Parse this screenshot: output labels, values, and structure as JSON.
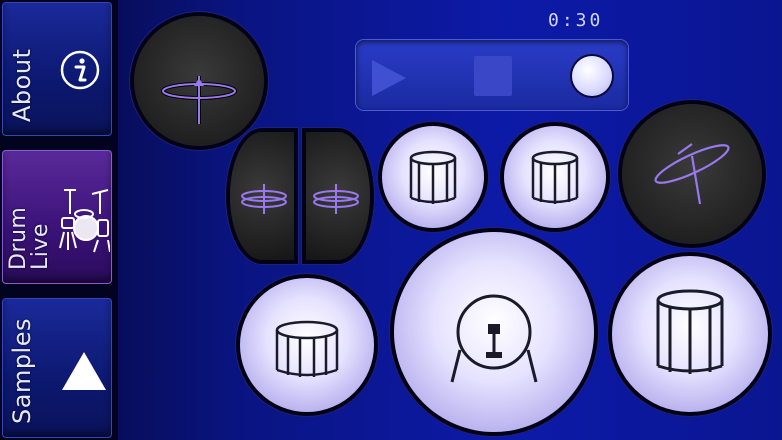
{
  "sidebar": {
    "tabs": [
      {
        "label": "About",
        "icon": "info-icon",
        "active": false
      },
      {
        "label": "Drum Live",
        "icon": "drum-kit-icon",
        "active": true
      },
      {
        "label": "Samples",
        "icon": "triangle-up-icon",
        "active": false
      }
    ]
  },
  "timer": {
    "value": "0:30"
  },
  "transport": {
    "play": "play-icon",
    "stop": "stop-icon",
    "record": "record-icon"
  },
  "pads": [
    {
      "name": "crash-cymbal-left",
      "icon": "cymbal-icon",
      "style": "dark"
    },
    {
      "name": "hihat-left",
      "icon": "hihat-icon",
      "style": "dark"
    },
    {
      "name": "hihat-right",
      "icon": "hihat-icon",
      "style": "dark"
    },
    {
      "name": "tom-1",
      "icon": "tom-drum-icon",
      "style": "light"
    },
    {
      "name": "tom-2",
      "icon": "tom-drum-icon",
      "style": "light"
    },
    {
      "name": "ride-cymbal",
      "icon": "cymbal-icon",
      "style": "dark"
    },
    {
      "name": "snare",
      "icon": "snare-drum-icon",
      "style": "light"
    },
    {
      "name": "bass-drum",
      "icon": "bass-drum-icon",
      "style": "light"
    },
    {
      "name": "floor-tom",
      "icon": "floor-tom-icon",
      "style": "light"
    }
  ],
  "colors": {
    "background": "#0c1aa8",
    "accent": "#7a4ad8",
    "pad_light": "#e6e2ff",
    "pad_dark": "#262626"
  }
}
